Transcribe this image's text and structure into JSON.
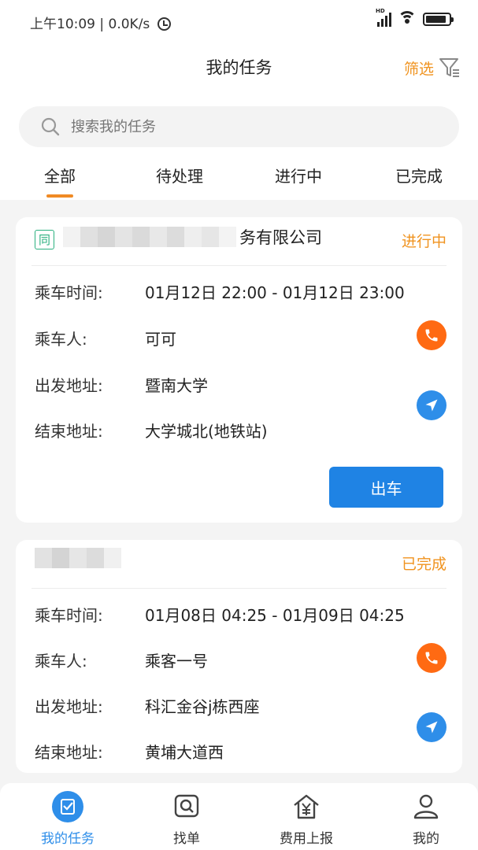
{
  "status_bar": {
    "time": "上午10:09 | 0.0K/s",
    "signal_badge": "HD",
    "battery_level": 0.9
  },
  "header": {
    "title": "我的任务",
    "filter_label": "筛选"
  },
  "search": {
    "placeholder": "搜索我的任务"
  },
  "tabs": [
    {
      "label": "全部",
      "active": true
    },
    {
      "label": "待处理",
      "active": false
    },
    {
      "label": "进行中",
      "active": false
    },
    {
      "label": "已完成",
      "active": false
    }
  ],
  "tasks": [
    {
      "tag": "同",
      "company_visible": "务有限公司",
      "status": "进行中",
      "status_color": "#f0931f",
      "time_label": "乘车时间:",
      "time_value": "01月12日 22:00 - 01月12日 23:00",
      "passenger_label": "乘车人:",
      "passenger_value": "可可",
      "start_label": "出发地址:",
      "start_value": "暨南大学",
      "end_label": "结束地址:",
      "end_value": "大学城北(地铁站)",
      "action_label": "出车"
    },
    {
      "status": "已完成",
      "status_color": "#f0931f",
      "time_label": "乘车时间:",
      "time_value": "01月08日 04:25 - 01月09日 04:25",
      "passenger_label": "乘车人:",
      "passenger_value": "乘客一号",
      "start_label": "出发地址:",
      "start_value": "科汇金谷j栋西座",
      "end_label": "结束地址:",
      "end_value": "黄埔大道西"
    }
  ],
  "bottom_nav": [
    {
      "label": "我的任务",
      "icon": "task-check-icon",
      "active": true
    },
    {
      "label": "找单",
      "icon": "search-order-icon",
      "active": false
    },
    {
      "label": "费用上报",
      "icon": "expense-house-icon",
      "active": false
    },
    {
      "label": "我的",
      "icon": "profile-icon",
      "active": false
    }
  ],
  "colors": {
    "accent_orange": "#f0931f",
    "primary_blue": "#1f83e4",
    "phone_orange": "#ff6a13"
  }
}
